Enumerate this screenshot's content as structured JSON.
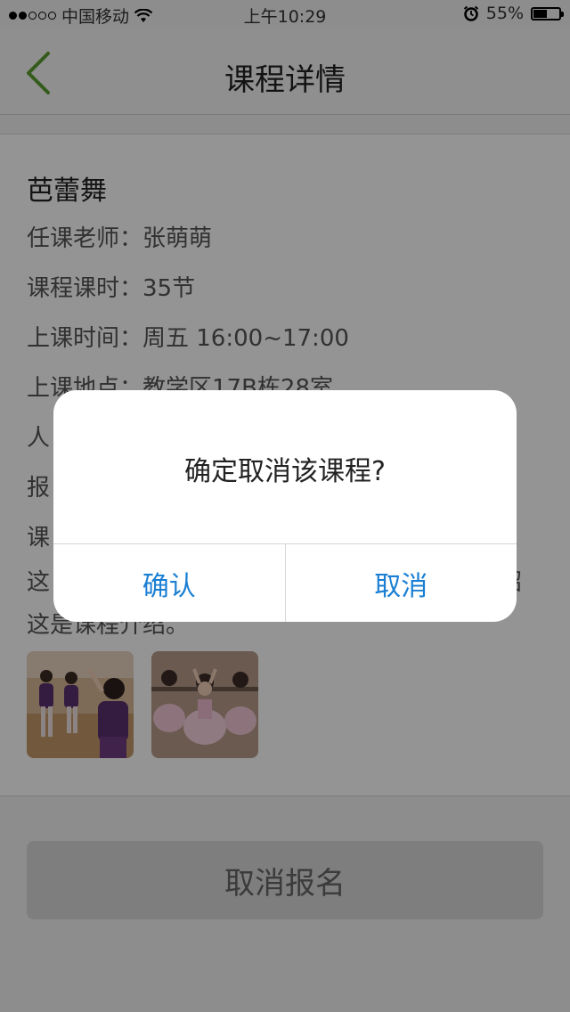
{
  "status_bar": {
    "carrier": "中国移动",
    "time": "上午10:29",
    "battery_text": "55%",
    "battery_level": 0.55,
    "signal_bars_filled": 2,
    "signal_bars_total": 5
  },
  "nav": {
    "title": "课程详情",
    "accent_color": "#5a9e2f"
  },
  "course": {
    "name": "芭蕾舞",
    "teacher": "任课老师：张萌萌",
    "hours": "课程课时：35节",
    "time": "上课时间：周五 16:00~17:00",
    "location": "上课地点：教学区17B栋28室",
    "people_partial": "人",
    "signup_partial": "报",
    "desc_line1": "课",
    "desc_line2_left": "这",
    "desc_line2_right": "绍",
    "desc_line3": "这是课程介绍。"
  },
  "actions": {
    "cancel_signup": "取消报名"
  },
  "dialog": {
    "message": "确定取消该课程?",
    "confirm": "确认",
    "cancel": "取消",
    "button_color": "#1a7fd4"
  }
}
